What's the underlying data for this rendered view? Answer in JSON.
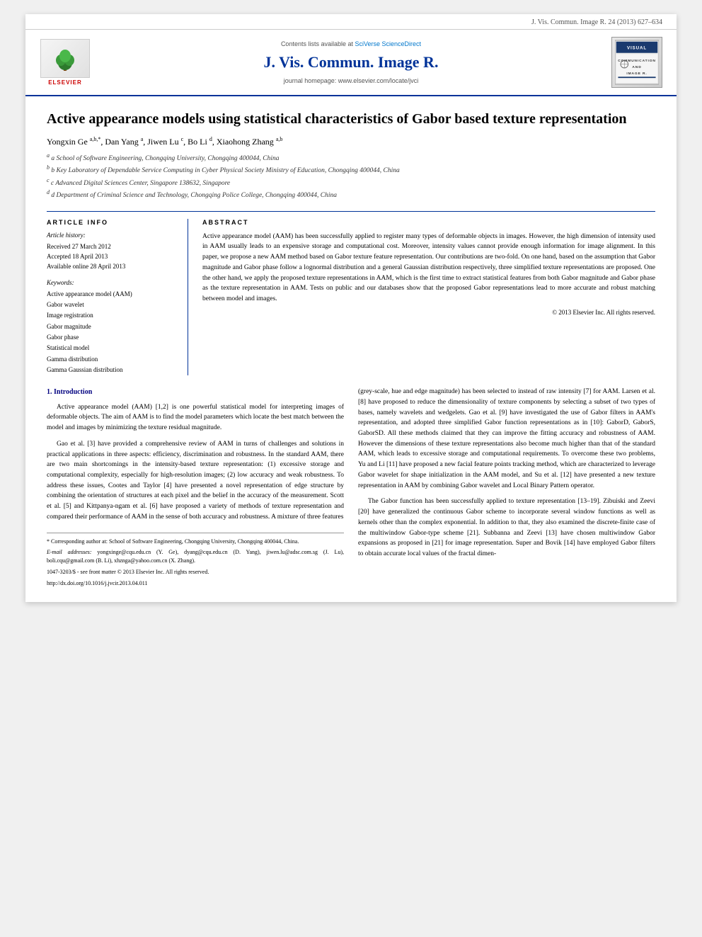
{
  "journal_ref": "J. Vis. Commun. Image R. 24 (2013) 627–634",
  "header": {
    "sciverse_text": "Contents lists available at",
    "sciverse_link": "SciVerse ScienceDirect",
    "journal_title": "J. Vis. Commun. Image R.",
    "homepage_text": "journal homepage: www.elsevier.com/locate/jvci",
    "elsevier_label": "ELSEVIER",
    "visual_logo_text": "VISUAL COMMUNICATION IMAGE R."
  },
  "article": {
    "title": "Active appearance models using statistical characteristics of Gabor based texture representation",
    "authors": "Yongxin Ge a,b,*, Dan Yang a, Jiwen Lu c, Bo Li d, Xiaohong Zhang a,b",
    "affiliations": [
      "a School of Software Engineering, Chongqing University, Chongqing 400044, China",
      "b Key Laboratory of Dependable Service Computing in Cyber Physical Society Ministry of Education, Chongqing 400044, China",
      "c Advanced Digital Sciences Center, Singapore 138632, Singapore",
      "d Department of Criminal Science and Technology, Chongqing Police College, Chongqing 400044, China"
    ]
  },
  "article_info": {
    "section_label": "ARTICLE INFO",
    "history_label": "Article history:",
    "received": "Received 27 March 2012",
    "accepted": "Accepted 18 April 2013",
    "available": "Available online 28 April 2013",
    "keywords_label": "Keywords:",
    "keywords": [
      "Active appearance model (AAM)",
      "Gabor wavelet",
      "Image registration",
      "Gabor magnitude",
      "Gabor phase",
      "Statistical model",
      "Gamma distribution",
      "Gamma Gaussian distribution"
    ]
  },
  "abstract": {
    "section_label": "ABSTRACT",
    "text": "Active appearance model (AAM) has been successfully applied to register many types of deformable objects in images. However, the high dimension of intensity used in AAM usually leads to an expensive storage and computational cost. Moreover, intensity values cannot provide enough information for image alignment. In this paper, we propose a new AAM method based on Gabor texture feature representation. Our contributions are two-fold. On one hand, based on the assumption that Gabor magnitude and Gabor phase follow a lognormal distribution and a general Gaussian distribution respectively, three simplified texture representations are proposed. One the other hand, we apply the proposed texture representations in AAM, which is the first time to extract statistical features from both Gabor magnitude and Gabor phase as the texture representation in AAM. Tests on public and our databases show that the proposed Gabor representations lead to more accurate and robust matching between model and images.",
    "copyright": "© 2013 Elsevier Inc. All rights reserved."
  },
  "introduction": {
    "section_title": "1. Introduction",
    "paragraphs": [
      "Active appearance model (AAM) [1,2] is one powerful statistical model for interpreting images of deformable objects. The aim of AAM is to find the model parameters which locate the best match between the model and images by minimizing the texture residual magnitude.",
      "Gao et al. [3] have provided a comprehensive review of AAM in turns of challenges and solutions in practical applications in three aspects: efficiency, discrimination and robustness. In the standard AAM, there are two main shortcomings in the intensity-based texture representation: (1) excessive storage and computational complexity, especially for high-resolution images; (2) low accuracy and weak robustness. To address these issues, Cootes and Taylor [4] have presented a novel representation of edge structure by combining the orientation of structures at each pixel and the belief in the accuracy of the measurement. Scott et al. [5] and Kittpanya-ngam et al. [6] have proposed a variety of methods of texture representation and compared their performance of AAM in the sense of both accuracy and robustness. A mixture of three features"
    ],
    "paragraphs_right": [
      "(grey-scale, hue and edge magnitude) has been selected to instead of raw intensity [7] for AAM. Larsen et al. [8] have proposed to reduce the dimensionality of texture components by selecting a subset of two types of bases, namely wavelets and wedgelets. Gao et al. [9] have investigated the use of Gabor filters in AAM's representation, and adopted three simplified Gabor function representations as in [10]: GaborD, GaborS, GaborSD. All these methods claimed that they can improve the fitting accuracy and robustness of AAM. However the dimensions of these texture representations also become much higher than that of the standard AAM, which leads to excessive storage and computational requirements. To overcome these two problems, Yu and Li [11] have proposed a new facial feature points tracking method, which are characterized to leverage Gabor wavelet for shape initialization in the AAM model, and Su et al. [12] have presented a new texture representation in AAM by combining Gabor wavelet and Local Binary Pattern operator.",
      "The Gabor function has been successfully applied to texture representation [13–19]. Zibuiski and Zeevi [20] have generalized the continuous Gabor scheme to incorporate several window functions as well as kernels other than the complex exponential. In addition to that, they also examined the discrete-finite case of the multiwindow Gabor-type scheme [21]. Subbanna and Zeevi [13] have chosen multiwindow Gabor expansions as proposed in [21] for image representation. Super and Bovik [14] have employed Gabor filters to obtain accurate local values of the fractal dimen-"
    ]
  },
  "footnotes": {
    "corresponding_author": "* Corresponding author at: School of Software Engineering, Chongqing University, Chongqing 400044, China.",
    "email_label": "E-mail addresses:",
    "emails": "yongxinge@cqu.edu.cn (Y. Ge), dyang@cqu.edu.cn (D. Yang), jiwen.lu@adsc.com.sg (J. Lu), boli.cqu@gmail.com (B. Li), xhznga@yahoo.com.cn (X. Zhang).",
    "issn": "1047-3203/$ - see front matter © 2013 Elsevier Inc. All rights reserved.",
    "doi": "http://dx.doi.org/10.1016/j.jvcir.2013.04.011"
  }
}
